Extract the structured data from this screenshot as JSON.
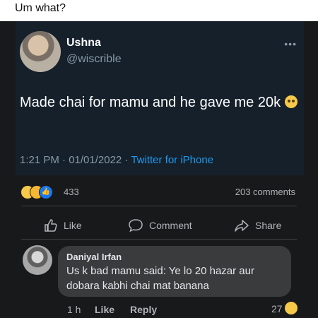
{
  "caption": "Um what?",
  "tweet": {
    "name": "Ushna",
    "handle": "@wiscrible",
    "more": "•••",
    "text": "Made chai for mamu and he gave me 20k",
    "text_emoji": "pleading-face-emoji",
    "time": "1:21 PM · 01/01/2022 · ",
    "source": "Twitter for iPhone"
  },
  "post": {
    "reaction_count": "433",
    "comments_count": "203 comments",
    "actions": {
      "like": "Like",
      "comment": "Comment",
      "share": "Share"
    }
  },
  "comment": {
    "author": "Daniyal Irfan",
    "text": "Us k bad mamu said: Ye lo 20 hazar aur dobara kabhi chai mat banana",
    "time": "1 h",
    "like": "Like",
    "reply": "Reply",
    "reaction_count": "27"
  },
  "colors": {
    "tweet_bg": "#15202b",
    "post_bg": "#18191a",
    "bubble_bg": "#3a3b3c",
    "link": "#1d9bf0",
    "like_blue": "#1877f2"
  }
}
